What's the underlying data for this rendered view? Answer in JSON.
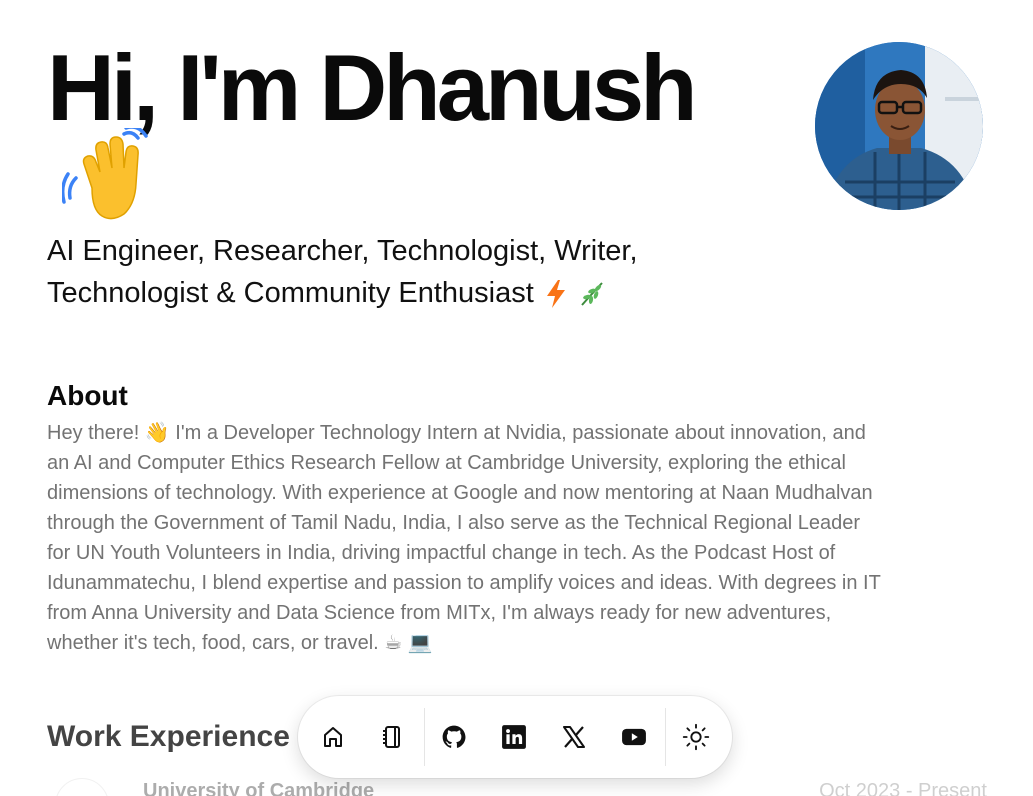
{
  "hero": {
    "title": "Hi, I'm Dhanush",
    "wave_icon": "waving-hand-emoji",
    "subtitle_line1": "AI Engineer, Researcher, Technologist, Writer,",
    "subtitle_line2": "Technologist & Community Enthusiast",
    "subtitle_icons": [
      "lightning-bolt-emoji",
      "herb-emoji"
    ],
    "avatar_alt": "Dhanush profile photo"
  },
  "about": {
    "title": "About",
    "lines": [
      "Hey there! 👋 I'm a Developer Technology Intern at Nvidia, passionate about innovation, and",
      "an AI and Computer Ethics Research Fellow at Cambridge University, exploring the ethical",
      "dimensions of technology. With experience at Google and now mentoring at Naan Mudhalvan",
      "through the Government of Tamil Nadu, India, I also serve as the Technical Regional Leader",
      "for UN Youth Volunteers in India, driving impactful change in tech. As the Podcast Host of",
      "Idunammatechu, I blend expertise and passion to amplify voices and ideas. With degrees in IT",
      "from Anna University and Data Science from MITx, I'm always ready for new adventures,",
      "whether it's tech, food, cars, or travel. ☕ 💻"
    ]
  },
  "work": {
    "title": "Work Experience",
    "items": [
      {
        "company": "University of Cambridge",
        "date": "Oct 2023 - Present"
      }
    ]
  },
  "dock": {
    "items": [
      {
        "icon": "home-icon"
      },
      {
        "icon": "notebook-icon"
      },
      {
        "icon": "github-icon"
      },
      {
        "icon": "linkedin-icon"
      },
      {
        "icon": "x-icon"
      },
      {
        "icon": "youtube-icon"
      },
      {
        "icon": "sun-icon"
      }
    ]
  },
  "colors": {
    "text_primary": "#0a0a0a",
    "text_muted": "#737373",
    "bolt": "#f97316",
    "herb": "#4ca64c"
  }
}
